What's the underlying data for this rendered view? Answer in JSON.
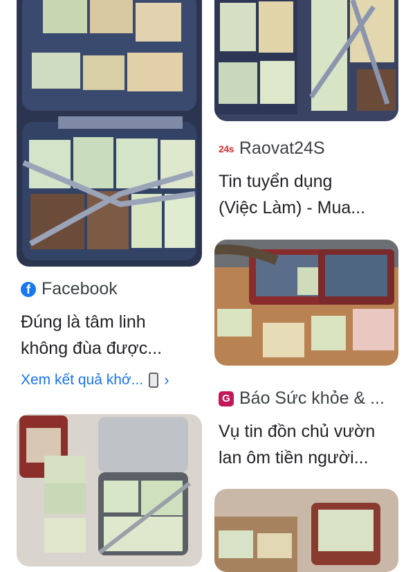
{
  "results": [
    {
      "source": {
        "name": "Facebook",
        "icon": "facebook-icon"
      },
      "title_lines": [
        "Đúng là tâm linh",
        "không đùa được..."
      ],
      "more_link": {
        "label": "Xem kết quả khớ...",
        "icon": "phone-icon",
        "chevron": "›"
      }
    },
    {
      "source": {
        "name": "Raovat24S",
        "icon_text": "24s",
        "icon": "raovat24s-icon"
      },
      "title_lines": [
        "Tin tuyển dụng",
        "(Việc Làm) - Mua..."
      ]
    },
    {
      "source": {
        "name": "Báo Sức khỏe & ...",
        "icon_text": "G",
        "icon": "bao-suc-khoe-icon"
      },
      "title_lines": [
        "Vụ tin đồn chủ vườn",
        "lan ôm tiền người..."
      ]
    }
  ],
  "colors": {
    "link": "#1a73e8",
    "facebook": "#1877f2",
    "raovat": "#d32f2f",
    "bao": "#c2185b"
  }
}
